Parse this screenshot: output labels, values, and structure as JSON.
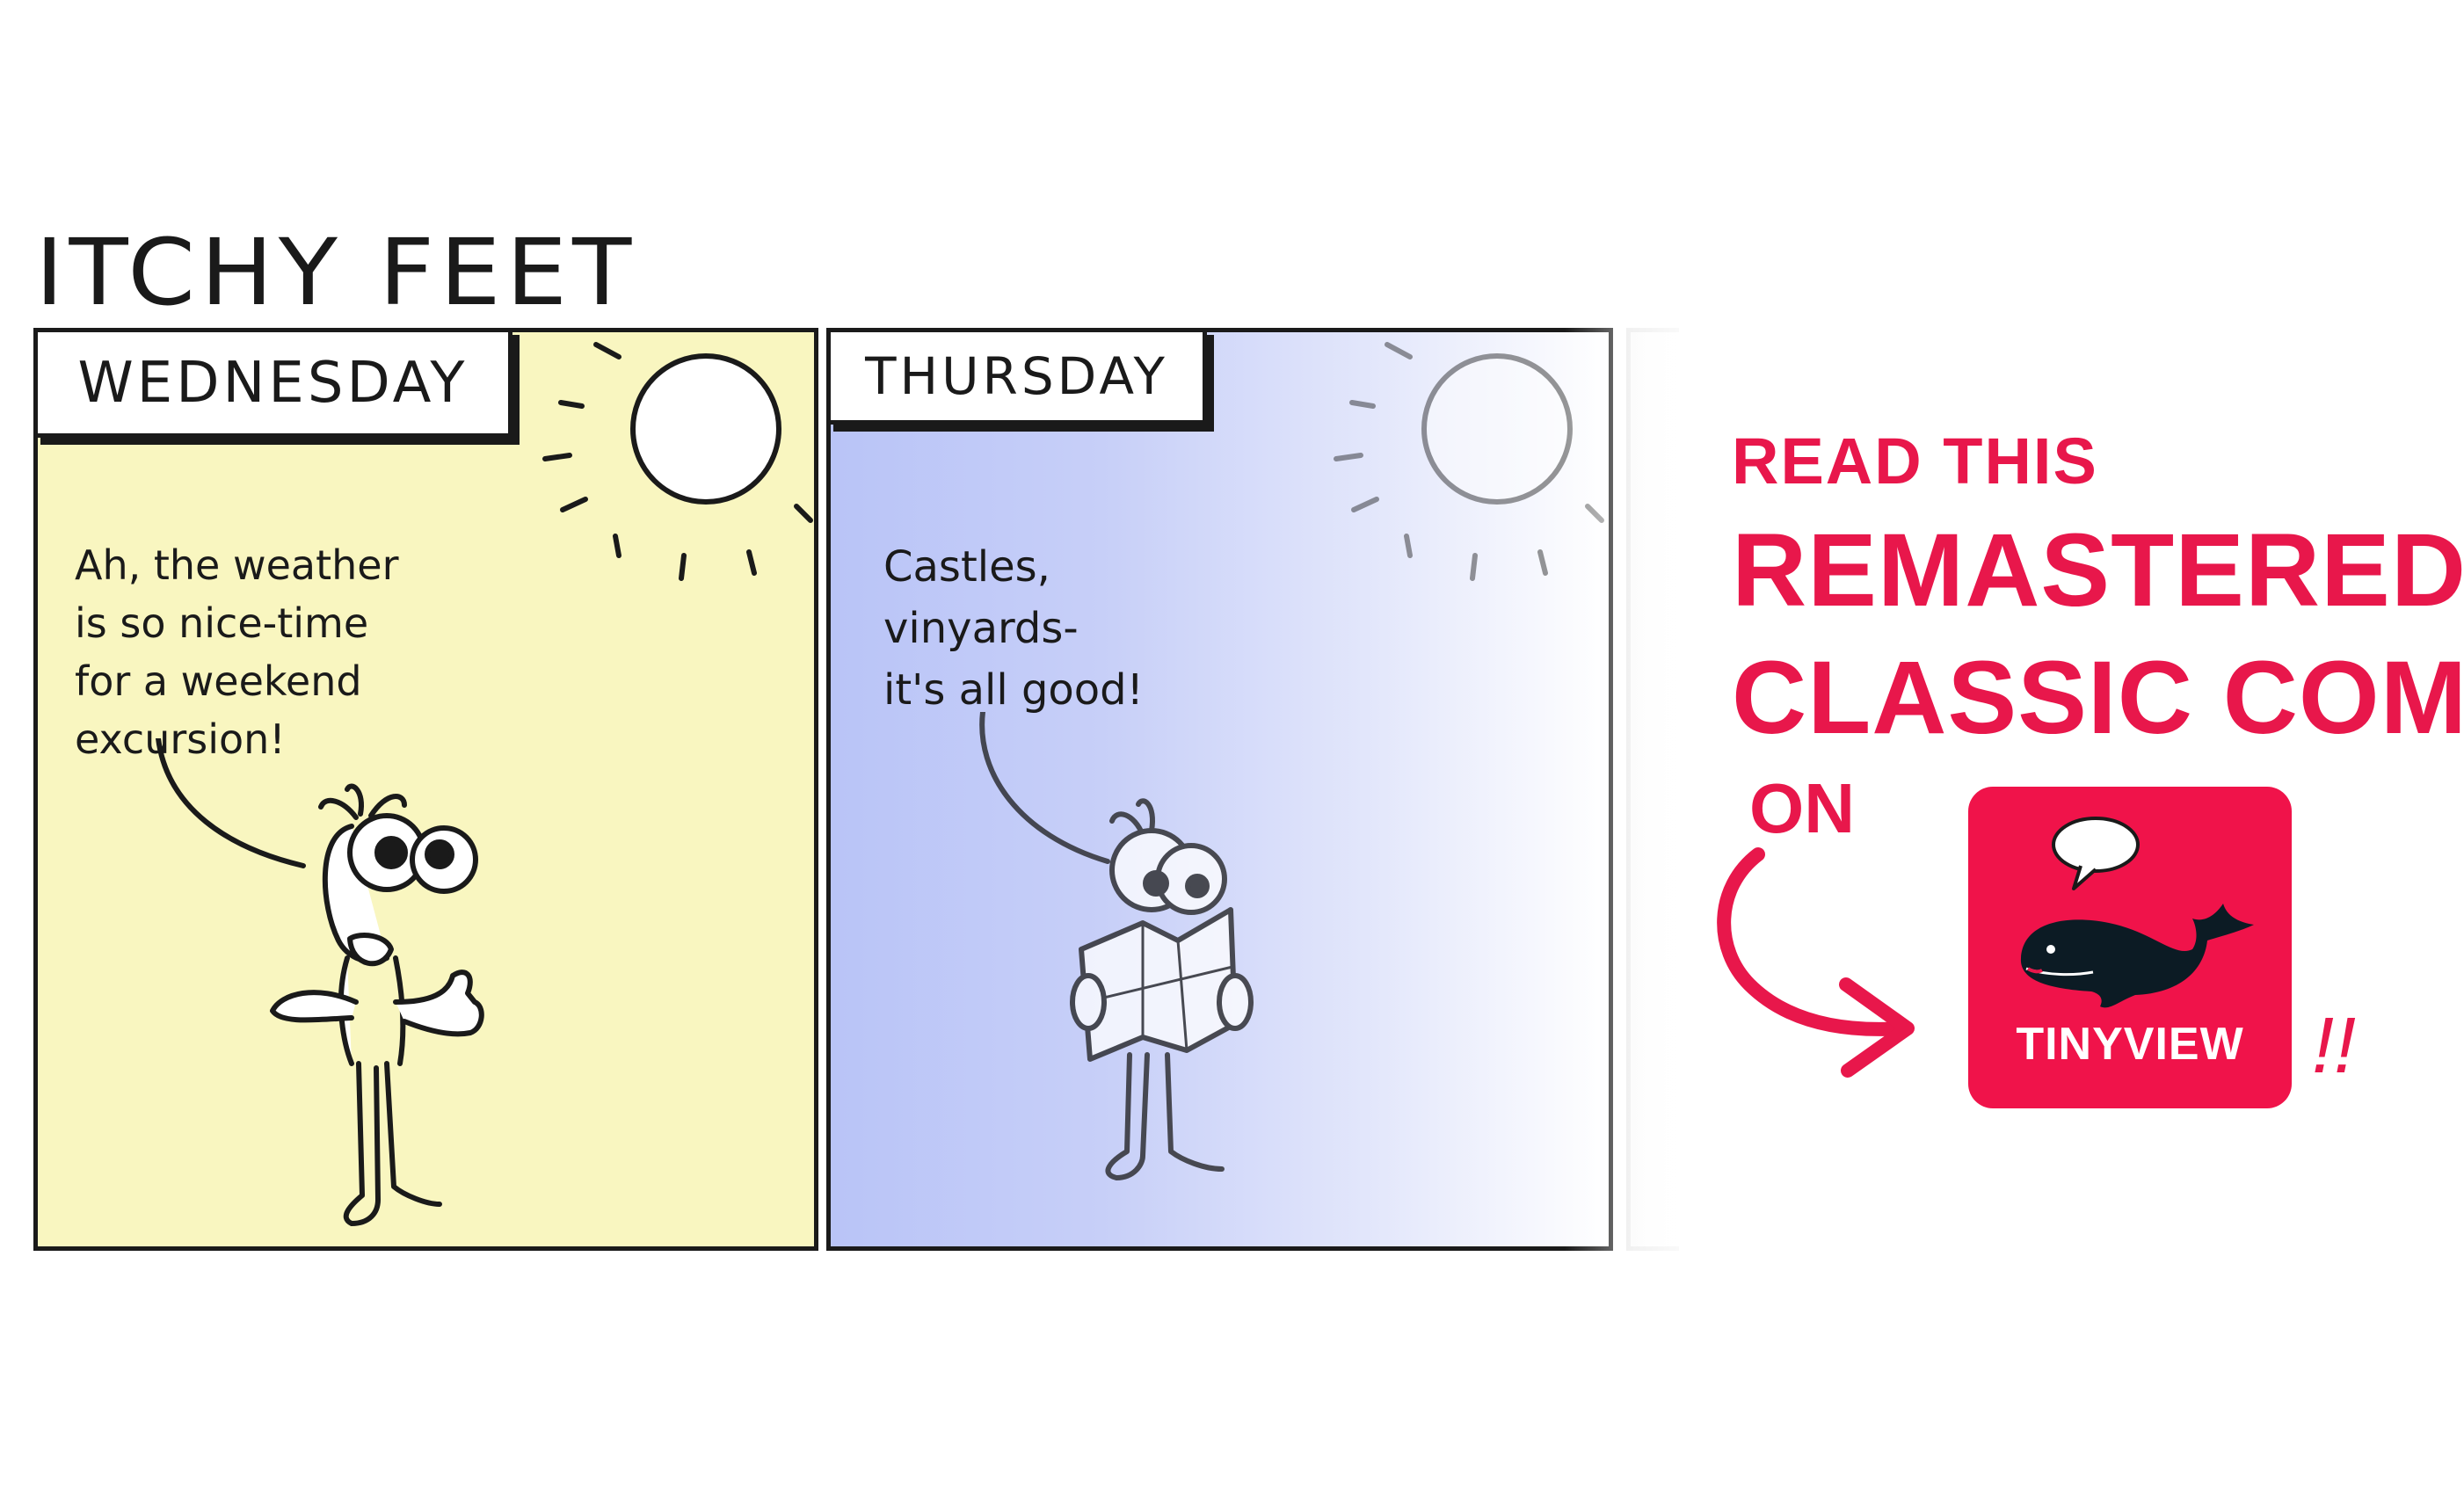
{
  "comic": {
    "title": "ITCHY FEET",
    "panels": [
      {
        "day": "WEDNESDAY",
        "speech": "Ah, the weather\nis so nice-time\nfor a weekend\nexcursion!",
        "background": "#f9f6c0"
      },
      {
        "day": "THURSDAY",
        "speech": "Castles,\nvinyards-\nit's all good!",
        "background": "#b9c4f7"
      }
    ]
  },
  "promo": {
    "line1": "READ THIS",
    "line2": "REMASTERED",
    "line3": "CLASSIC COMIC",
    "line4": "ON",
    "exclaim": "!!",
    "color": "#e8174b"
  },
  "app": {
    "name": "TINYVIEW",
    "color": "#f0134a"
  },
  "icons": [
    "sun-icon",
    "whale-icon",
    "speech-bubble-icon",
    "curved-arrow-icon"
  ]
}
